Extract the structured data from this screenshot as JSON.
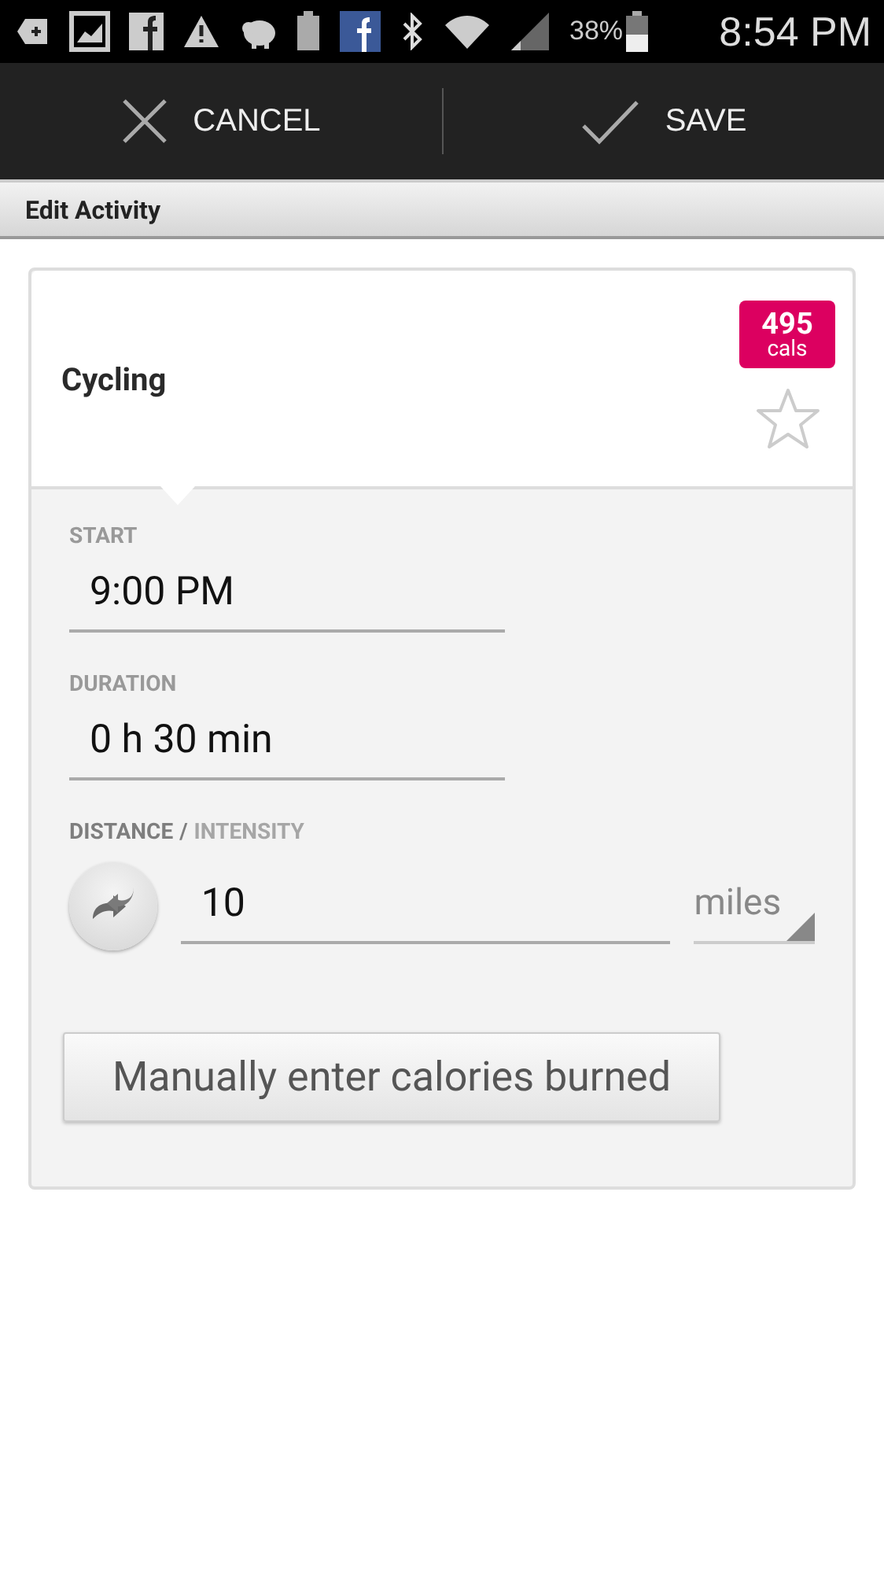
{
  "status_bar": {
    "battery": "38%",
    "time": "8:54 PM"
  },
  "action_bar": {
    "buttons": [
      {
        "kind": "cancel",
        "label": "CANCEL"
      },
      {
        "kind": "save",
        "label": "SAVE"
      }
    ]
  },
  "section": {
    "title": "Edit Activity"
  },
  "activity": {
    "name": "Cycling",
    "calories": "495",
    "calories_unit": "cals",
    "starred": false
  },
  "fields": [
    {
      "label": "START",
      "value": "9:00 PM"
    },
    {
      "label": "DURATION",
      "value": "0 h 30 min"
    }
  ],
  "measure": {
    "modes": [
      {
        "label": "DISTANCE",
        "selected": true
      },
      {
        "label": "INTENSITY",
        "selected": false
      }
    ],
    "separator": "/",
    "value": "10",
    "unit": "miles"
  },
  "manual_button": {
    "label": "Manually enter calories burned"
  }
}
